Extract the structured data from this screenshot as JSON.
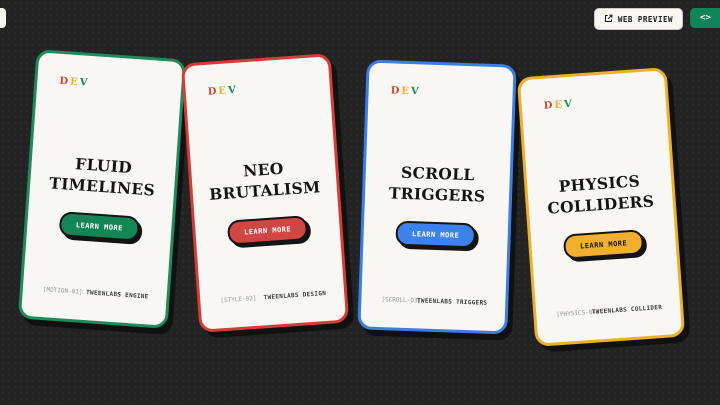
{
  "header": {
    "preview_label": "WEB PREVIEW",
    "preview_icon": "external-link-icon",
    "code_label": "<>",
    "code_icon": "code-icon",
    "code_color": "#11845c"
  },
  "logo": {
    "d": "D",
    "e": "E",
    "v": "V"
  },
  "cards": [
    {
      "title_line1": "FLUID",
      "title_line2": "TIMELINES",
      "button": "LEARN MORE",
      "code": "[MOTION-01]",
      "brand": "TWEENLABS ENGINE",
      "accent": "#1f8a5c"
    },
    {
      "title_line1": "NEO",
      "title_line2": "BRUTALISM",
      "button": "LEARN MORE",
      "code": "[STYLE-02]",
      "brand": "TWEENLABS DESIGN",
      "accent": "#d43d37"
    },
    {
      "title_line1": "SCROLL",
      "title_line2": "TRIGGERS",
      "button": "LEARN MORE",
      "code": "[SCROLL-03]",
      "brand": "TWEENLABS TRIGGERS",
      "accent": "#3b7fe4"
    },
    {
      "title_line1": "PHYSICS",
      "title_line2": "COLLIDERS",
      "button": "LEARN MORE",
      "code": "[PHYSICS-04]",
      "brand": "TWEENLABS COLLIDER",
      "accent": "#ecb02c"
    }
  ]
}
